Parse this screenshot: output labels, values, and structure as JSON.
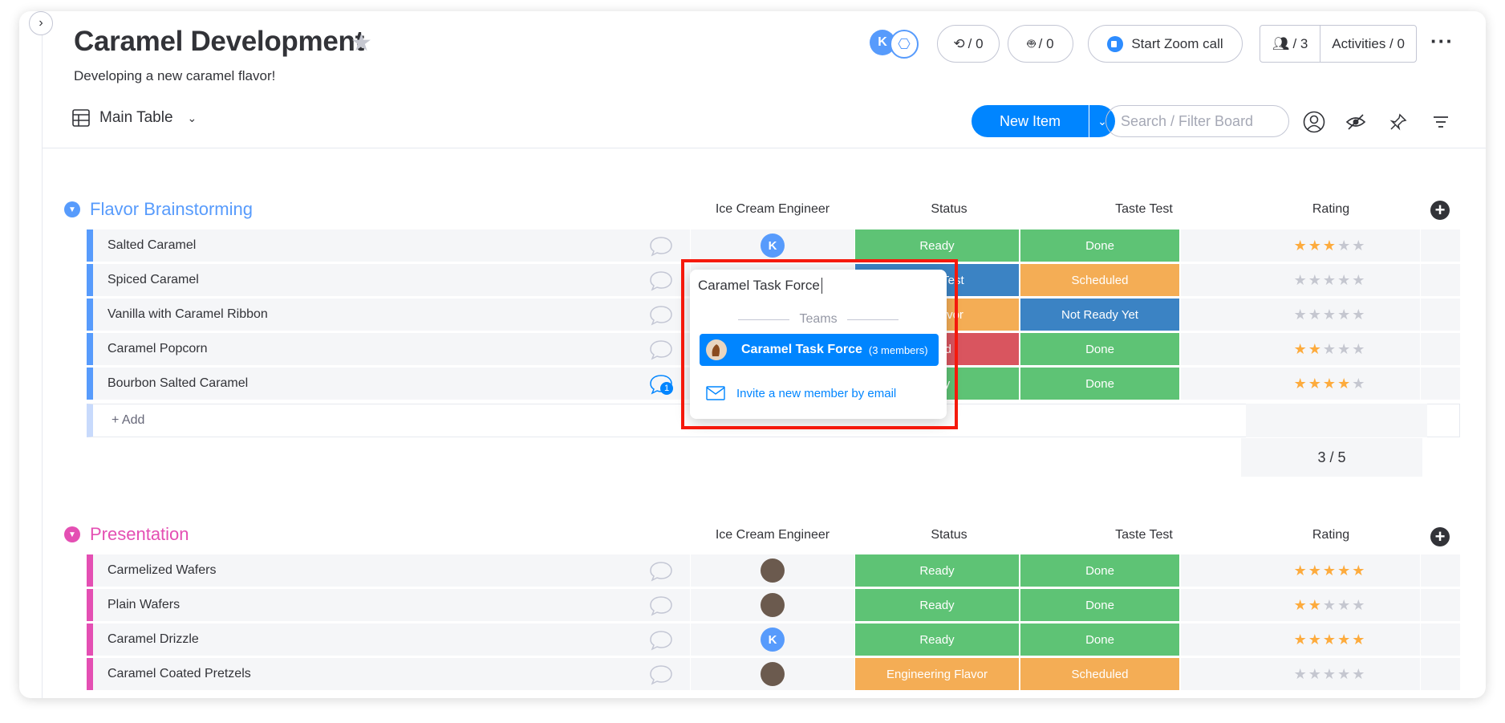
{
  "board": {
    "title": "Caramel Development",
    "description": "Developing a new caramel flavor!",
    "view_name": "Main Table"
  },
  "header": {
    "avatar_initial": "K",
    "integrations_count": "/ 0",
    "automations_count": "/ 0",
    "zoom_label": "Start Zoom call",
    "members_count": "/ 3",
    "activities_label": "Activities / 0",
    "new_item_label": "New Item",
    "search_placeholder": "Search / Filter Board"
  },
  "columns": {
    "engineer": "Ice Cream Engineer",
    "status": "Status",
    "taste_test": "Taste Test",
    "rating": "Rating"
  },
  "colors": {
    "ready": "#5ec375",
    "done": "#5ec375",
    "scheduled": "#f4ad55",
    "not_ready": "#3b83c4",
    "taste_test": "#3b83c4",
    "stuck": "#d9555f",
    "engineering": "#f4ad55",
    "group1": "#579bfc",
    "group2": "#e2445c"
  },
  "groups": [
    {
      "name": "Flavor Brainstorming",
      "add_label": "+ Add",
      "rating_summary": "3  / 5",
      "rows": [
        {
          "name": "Salted Caramel",
          "engineer": "K",
          "status": "Ready",
          "taste": "Done",
          "rating": 3,
          "comments": ""
        },
        {
          "name": "Spiced Caramel",
          "engineer": "",
          "status": "Taste Test",
          "taste": "Scheduled",
          "rating": 0,
          "comments": ""
        },
        {
          "name": "Vanilla with Caramel Ribbon",
          "engineer": "",
          "status": "ing Flavor",
          "taste": "Not Ready Yet",
          "rating": 0,
          "comments": ""
        },
        {
          "name": "Caramel Popcorn",
          "engineer": "",
          "status": "celed",
          "taste": "Done",
          "rating": 2,
          "comments": ""
        },
        {
          "name": "Bourbon Salted Caramel",
          "engineer": "",
          "status": "eady",
          "taste": "Done",
          "rating": 4,
          "comments": "1"
        }
      ]
    },
    {
      "name": "Presentation",
      "rows": [
        {
          "name": "Carmelized Wafers",
          "engineer": "photo",
          "status": "Ready",
          "taste": "Done",
          "rating": 5
        },
        {
          "name": "Plain Wafers",
          "engineer": "photo",
          "status": "Ready",
          "taste": "Done",
          "rating": 2
        },
        {
          "name": "Caramel Drizzle",
          "engineer": "K",
          "status": "Ready",
          "taste": "Done",
          "rating": 5
        },
        {
          "name": "Caramel Coated Pretzels",
          "engineer": "photo",
          "status": "Engineering Flavor",
          "taste": "Scheduled",
          "rating": 0
        }
      ]
    }
  ],
  "popup": {
    "input_value": "Caramel Task Force",
    "section_label": "Teams",
    "team_name": "Caramel Task Force",
    "team_members": "(3 members)",
    "invite_label": "Invite a new member by email"
  }
}
